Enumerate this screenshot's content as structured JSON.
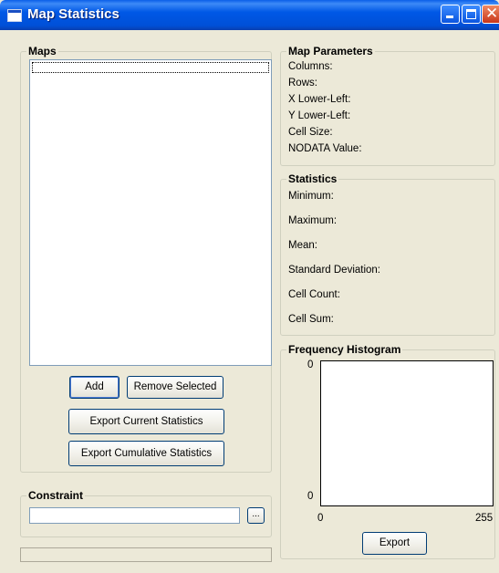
{
  "window": {
    "title": "Map Statistics"
  },
  "maps": {
    "label": "Maps",
    "items": [],
    "add_label": "Add",
    "remove_label": "Remove Selected",
    "export_current_label": "Export Current Statistics",
    "export_cumulative_label": "Export Cumulative Statistics"
  },
  "map_parameters": {
    "label": "Map Parameters",
    "columns": "Columns:",
    "rows": "Rows:",
    "x_lower_left": "X Lower-Left:",
    "y_lower_left": "Y Lower-Left:",
    "cell_size": "Cell Size:",
    "nodata": "NODATA Value:"
  },
  "statistics": {
    "label": "Statistics",
    "minimum": "Minimum:",
    "maximum": "Maximum:",
    "mean": "Mean:",
    "std_dev": "Standard Deviation:",
    "cell_count": "Cell Count:",
    "cell_sum": "Cell Sum:"
  },
  "histogram": {
    "label": "Frequency Histogram",
    "y_max": "0",
    "y_min": "0",
    "x_min": "0",
    "x_max": "255",
    "export_label": "Export"
  },
  "constraint": {
    "label": "Constraint",
    "value": "",
    "browse_label": "..."
  },
  "status_bar": {
    "text": ""
  }
}
